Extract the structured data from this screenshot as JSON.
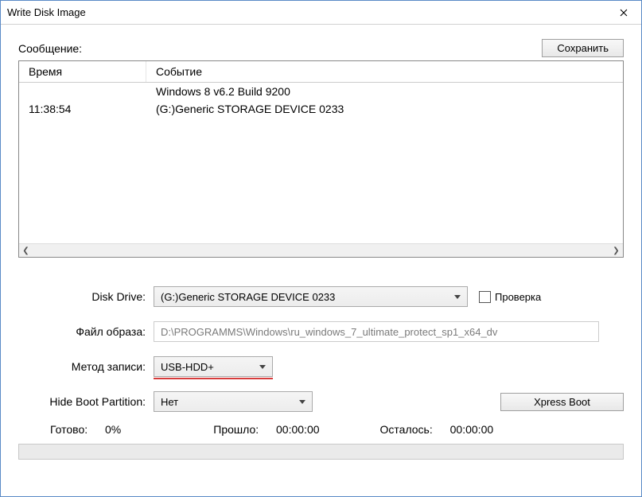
{
  "window": {
    "title": "Write Disk Image"
  },
  "toolbar": {
    "message_label": "Сообщение:",
    "save_button": "Сохранить"
  },
  "log": {
    "header_time": "Время",
    "header_event": "Событие",
    "rows": [
      {
        "time": "",
        "event": "Windows 8 v6.2 Build 9200"
      },
      {
        "time": "11:38:54",
        "event": "(G:)Generic STORAGE DEVICE  0233"
      }
    ]
  },
  "form": {
    "disk_drive_label": "Disk Drive:",
    "disk_drive_value": "(G:)Generic STORAGE DEVICE  0233",
    "verify_label": "Проверка",
    "image_file_label": "Файл образа:",
    "image_file_value": "D:\\PROGRAMMS\\Windows\\ru_windows_7_ultimate_protect_sp1_x64_dv",
    "write_method_label": "Метод записи:",
    "write_method_value": "USB-HDD+",
    "hide_boot_label": "Hide Boot Partition:",
    "hide_boot_value": "Нет",
    "xpress_boot": "Xpress Boot"
  },
  "status": {
    "ready_label": "Готово:",
    "ready_value": "0%",
    "elapsed_label": "Прошло:",
    "elapsed_value": "00:00:00",
    "remaining_label": "Осталось:",
    "remaining_value": "00:00:00"
  }
}
